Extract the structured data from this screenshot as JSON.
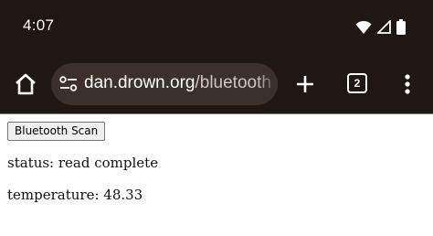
{
  "statusbar": {
    "time": "4:07",
    "icons": [
      "wifi-icon",
      "cell-signal-icon",
      "battery-icon"
    ]
  },
  "toolbar": {
    "url_host": "dan.drown.org",
    "url_path": "/bluetooth",
    "tab_count": "2",
    "icons": [
      "home-icon",
      "site-settings-icon",
      "new-tab-icon",
      "tab-switcher-icon",
      "more-options-icon"
    ]
  },
  "page": {
    "scan_button_label": "Bluetooth Scan",
    "status_text": "status: read complete",
    "temperature_text": "temperature: 48.33"
  },
  "colors": {
    "chrome_bg": "#1f1713",
    "omnibox_bg": "#3b302b",
    "page_bg": "#ffffff"
  }
}
